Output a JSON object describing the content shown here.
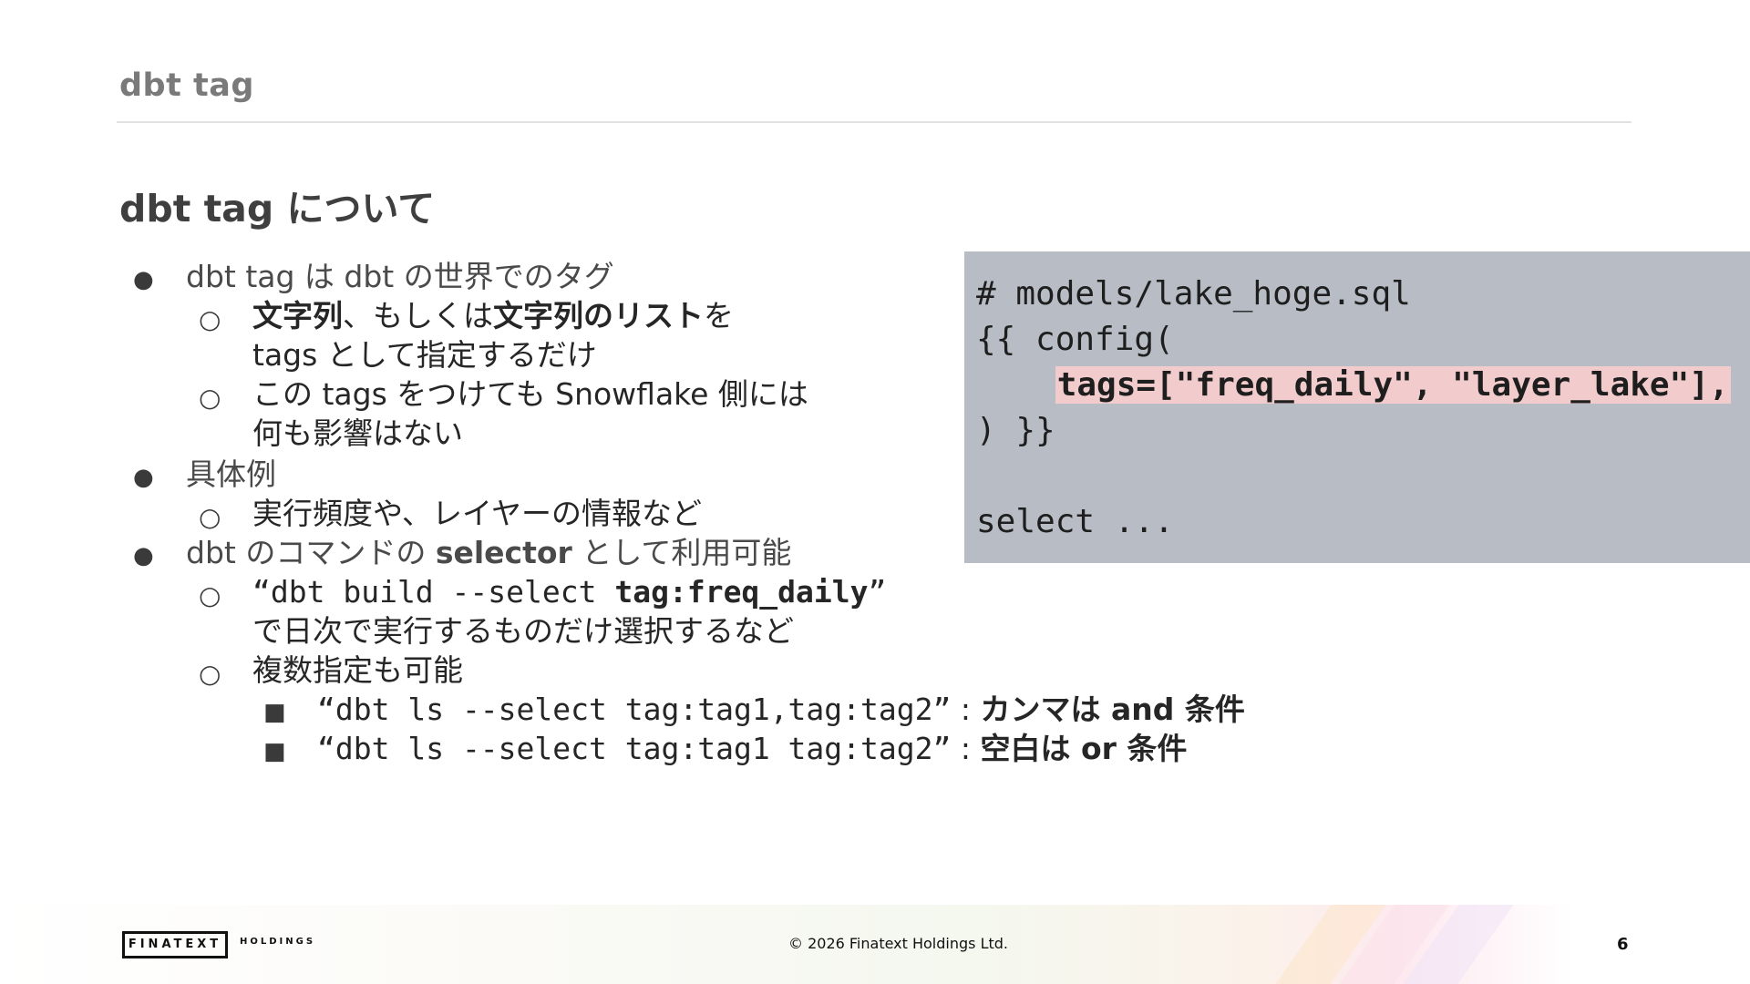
{
  "header": {
    "title": "dbt tag"
  },
  "section": {
    "title": "dbt tag について"
  },
  "bullets": {
    "b1": "dbt tag は dbt の世界でのタグ",
    "b1_s1_bold1": "文字列",
    "b1_s1_text1": "、もしくは",
    "b1_s1_bold2": "文字列のリスト",
    "b1_s1_text2": "を",
    "b1_s1_cont": "tags として指定するだけ",
    "b1_s2": "この tags をつけても Snowflake 側には",
    "b1_s2_cont": "何も影響はない",
    "b2": "具体例",
    "b2_s1": "実行頻度や、レイヤーの情報など",
    "b3_text1": "dbt のコマンドの ",
    "b3_bold": "selector",
    "b3_text2": " として利用可能",
    "b3_s1_open": "“dbt build --select ",
    "b3_s1_bold": "tag:freq_daily",
    "b3_s1_close": "”",
    "b3_s1_cont": "で日次で実行するものだけ選択するなど",
    "b3_s2": "複数指定も可能",
    "b3_s2_i1_code": "“dbt ls --select tag:tag1,tag:tag2”",
    "b3_s2_i1_sep": " : ",
    "b3_s2_i1_bold": "カンマは and 条件",
    "b3_s2_i2_code": "“dbt ls --select tag:tag1 tag:tag2”",
    "b3_s2_i2_sep": " : ",
    "b3_s2_i2_bold": "空白は or 条件"
  },
  "markers": {
    "level1": "●",
    "level2": "○",
    "level3": "■"
  },
  "code": {
    "line1": "# models/lake_hoge.sql",
    "line2": "{{ config(",
    "line3_indent": "    ",
    "line3_highlight": "tags=[\"freq_daily\", \"layer_lake\"],",
    "line4": ") }}",
    "line5": "",
    "line6": "select ..."
  },
  "footer": {
    "logo": "FINATEXT",
    "logo_sub": "HOLDINGS",
    "copyright": "© 2026 Finatext Holdings Ltd.",
    "page_number": "6"
  },
  "colors": {
    "code_background": "#b7bcc5",
    "code_highlight": "#f2cccc",
    "header_text": "#7a7a7a"
  }
}
